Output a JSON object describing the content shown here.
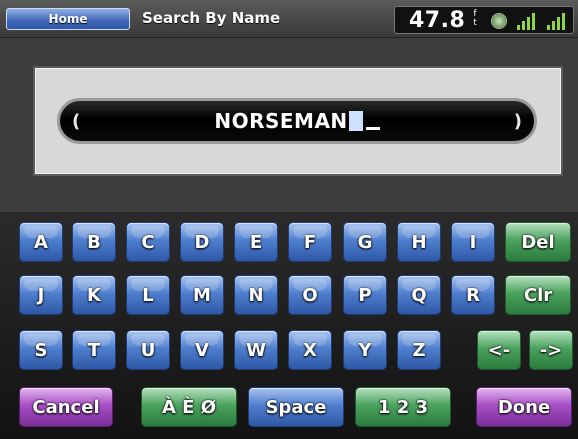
{
  "topbar": {
    "home_label": "Home",
    "title": "Search By Name",
    "depth": "47.8",
    "depth_unit": "f t",
    "signal_labels": [
      "",
      ""
    ]
  },
  "entry": {
    "text": "NORSEMAN",
    "left_arrow": "(",
    "right_arrow": ")"
  },
  "keyboard": {
    "row1": [
      "A",
      "B",
      "C",
      "D",
      "E",
      "F",
      "G",
      "H",
      "I"
    ],
    "row2": [
      "J",
      "K",
      "L",
      "M",
      "N",
      "O",
      "P",
      "Q",
      "R"
    ],
    "row3": [
      "S",
      "T",
      "U",
      "V",
      "W",
      "X",
      "Y",
      "Z"
    ],
    "del_label": "Del",
    "clr_label": "Clr",
    "left_label": "<-",
    "right_label": "->",
    "cancel_label": "Cancel",
    "accents_label": "À È Ø",
    "space_label": "Space",
    "numbers_label": "1 2 3",
    "done_label": "Done"
  },
  "colors": {
    "letter_key": "#4f7fcf",
    "action_key": "#4ba35e",
    "nav_key": "#a84fc5"
  }
}
